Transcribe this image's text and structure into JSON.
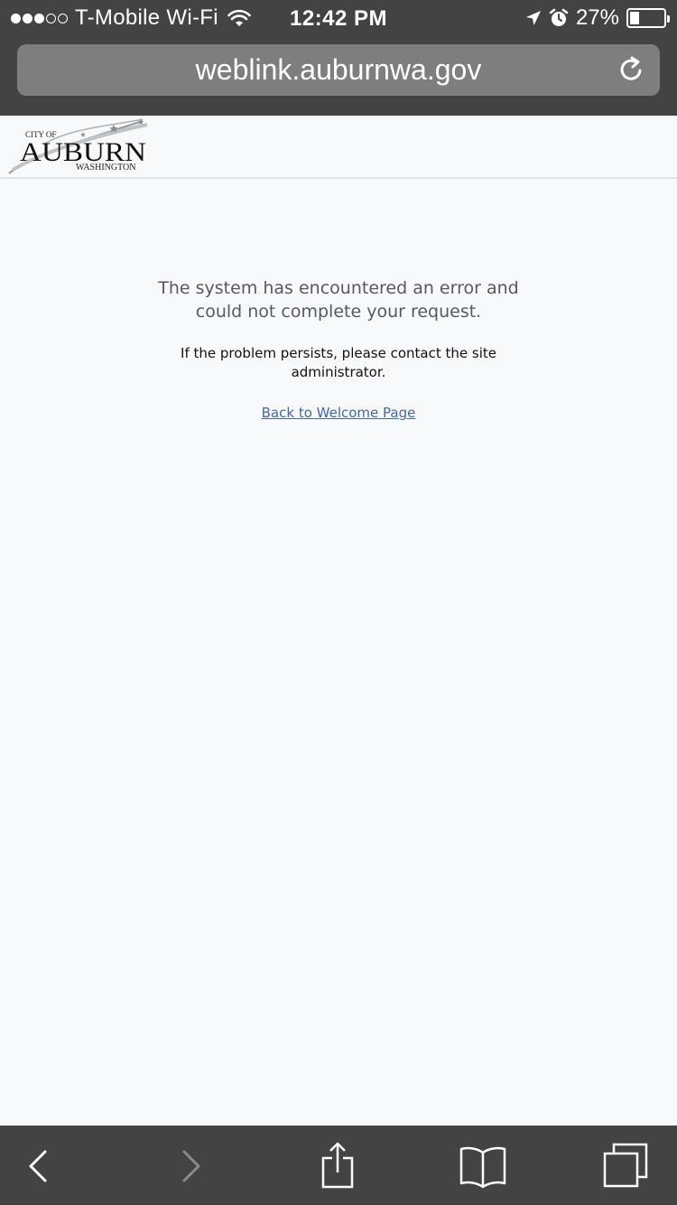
{
  "status_bar": {
    "carrier": "T-Mobile Wi-Fi",
    "time": "12:42 PM",
    "battery_percent": "27%",
    "battery_level": 0.27,
    "signal_bars_filled": 3,
    "signal_bars_total": 5,
    "icons": [
      "wifi-icon",
      "location-arrow-icon",
      "alarm-icon",
      "battery-icon"
    ]
  },
  "address_bar": {
    "url": "weblink.auburnwa.gov",
    "reload_icon": "reload-icon"
  },
  "site_header": {
    "logo": {
      "top_text": "CITY OF",
      "main_text": "AUBURN",
      "bottom_text": "WASHINGTON"
    }
  },
  "error": {
    "message": "The system has encountered an error and could not complete your request.",
    "detail": "If the problem persists, please contact the site administrator.",
    "link_label": "Back to Welcome Page",
    "link_color": "#3f67b6"
  },
  "toolbar": {
    "icons": [
      "back-icon",
      "forward-icon",
      "share-icon",
      "bookmarks-icon",
      "tabs-icon"
    ]
  },
  "colors": {
    "chrome": "#434343",
    "url_field": "#7e7e7e",
    "page_bg": "#f8f9fb"
  }
}
